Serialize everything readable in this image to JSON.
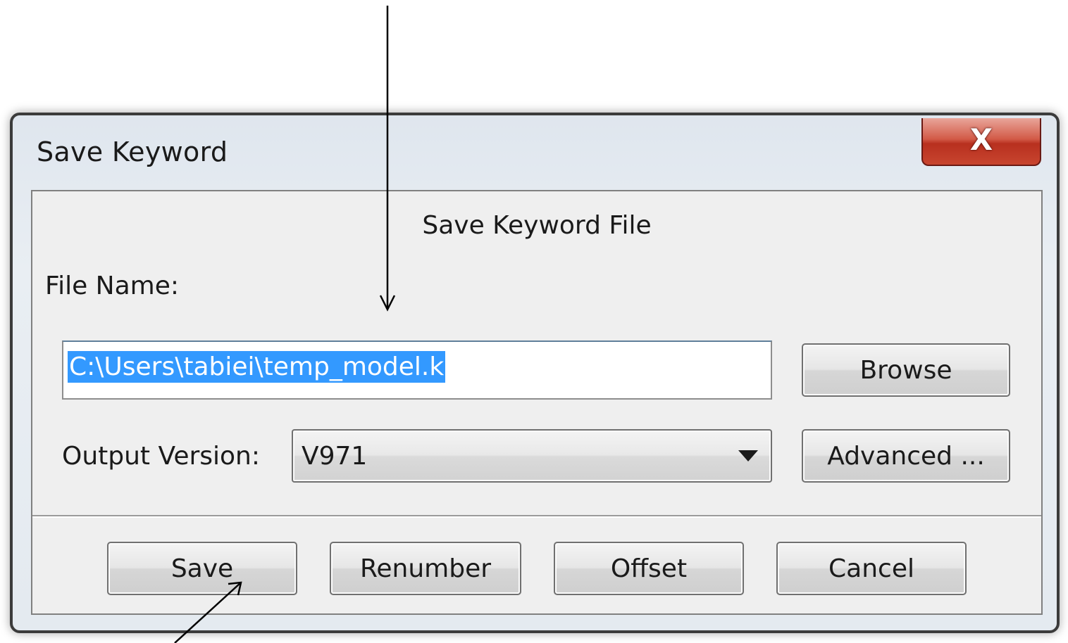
{
  "window": {
    "title": "Save Keyword",
    "close_label": "X"
  },
  "dialog": {
    "group_title": "Save Keyword File",
    "file_name_label": "File Name:",
    "file_name_value": "C:\\Users\\tabiei\\temp_model.k",
    "browse_label": "Browse",
    "output_version_label": "Output Version:",
    "output_version_value": "V971",
    "advanced_label": "Advanced ..."
  },
  "footer": {
    "save_label": "Save",
    "renumber_label": "Renumber",
    "offset_label": "Offset",
    "cancel_label": "Cancel"
  },
  "colors": {
    "selection": "#3399ff",
    "close_button": "#c8452f",
    "window_border": "#3b3b3b"
  },
  "icons": [
    "close-icon",
    "dropdown-arrow-icon"
  ]
}
